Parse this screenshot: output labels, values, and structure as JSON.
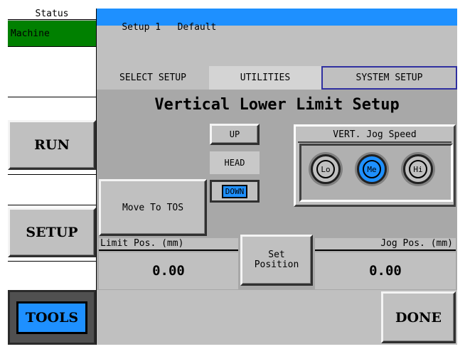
{
  "status": {
    "label": "Status",
    "machine": "Machine"
  },
  "header": {
    "setup": "Setup 1",
    "name": "Default"
  },
  "tabs": {
    "select_setup": "SELECT SETUP",
    "utilities": "UTILITIES",
    "system_setup": "SYSTEM SETUP"
  },
  "page_title": "Vertical Lower Limit Setup",
  "sidebar": {
    "run": "RUN",
    "setup": "SETUP",
    "tools": "TOOLS"
  },
  "head": {
    "up": "UP",
    "label": "HEAD",
    "down": "DOWN"
  },
  "jog_speed": {
    "title": "VERT. Jog Speed",
    "lo": "Lo",
    "me": "Me",
    "hi": "Hi"
  },
  "move_to_tos": "Move To TOS",
  "limit_pos": {
    "label": "Limit Pos. (mm)",
    "value": "0.00"
  },
  "set_position": {
    "line1": "Set",
    "line2": "Position"
  },
  "jog_pos": {
    "label": "Jog Pos. (mm)",
    "value": "0.00"
  },
  "done": "DONE",
  "colors": {
    "accent_blue": "#1e90ff",
    "machine_green": "#008000",
    "bg_gray": "#c0c0c0",
    "panel_gray": "#a8a8a8"
  }
}
